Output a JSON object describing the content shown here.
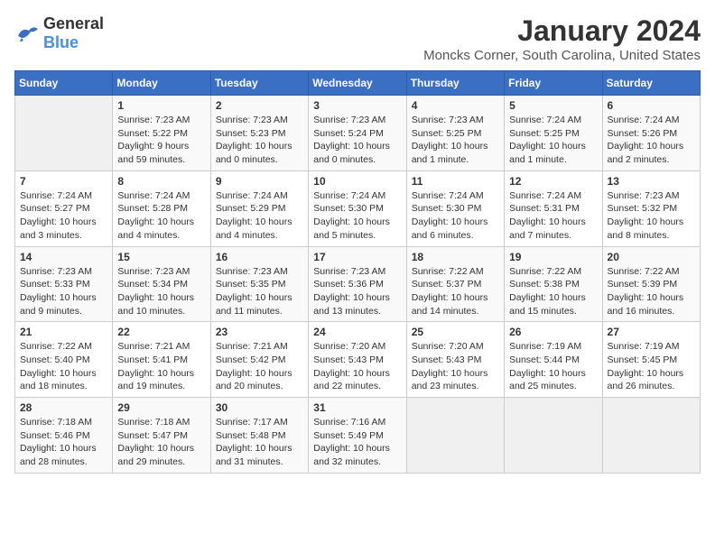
{
  "logo": {
    "general": "General",
    "blue": "Blue"
  },
  "title": "January 2024",
  "subtitle": "Moncks Corner, South Carolina, United States",
  "days_of_week": [
    "Sunday",
    "Monday",
    "Tuesday",
    "Wednesday",
    "Thursday",
    "Friday",
    "Saturday"
  ],
  "weeks": [
    [
      {
        "day": "",
        "empty": true
      },
      {
        "day": "1",
        "sunrise": "Sunrise: 7:23 AM",
        "sunset": "Sunset: 5:22 PM",
        "daylight": "Daylight: 9 hours and 59 minutes."
      },
      {
        "day": "2",
        "sunrise": "Sunrise: 7:23 AM",
        "sunset": "Sunset: 5:23 PM",
        "daylight": "Daylight: 10 hours and 0 minutes."
      },
      {
        "day": "3",
        "sunrise": "Sunrise: 7:23 AM",
        "sunset": "Sunset: 5:24 PM",
        "daylight": "Daylight: 10 hours and 0 minutes."
      },
      {
        "day": "4",
        "sunrise": "Sunrise: 7:23 AM",
        "sunset": "Sunset: 5:25 PM",
        "daylight": "Daylight: 10 hours and 1 minute."
      },
      {
        "day": "5",
        "sunrise": "Sunrise: 7:24 AM",
        "sunset": "Sunset: 5:25 PM",
        "daylight": "Daylight: 10 hours and 1 minute."
      },
      {
        "day": "6",
        "sunrise": "Sunrise: 7:24 AM",
        "sunset": "Sunset: 5:26 PM",
        "daylight": "Daylight: 10 hours and 2 minutes."
      }
    ],
    [
      {
        "day": "7",
        "sunrise": "Sunrise: 7:24 AM",
        "sunset": "Sunset: 5:27 PM",
        "daylight": "Daylight: 10 hours and 3 minutes."
      },
      {
        "day": "8",
        "sunrise": "Sunrise: 7:24 AM",
        "sunset": "Sunset: 5:28 PM",
        "daylight": "Daylight: 10 hours and 4 minutes."
      },
      {
        "day": "9",
        "sunrise": "Sunrise: 7:24 AM",
        "sunset": "Sunset: 5:29 PM",
        "daylight": "Daylight: 10 hours and 4 minutes."
      },
      {
        "day": "10",
        "sunrise": "Sunrise: 7:24 AM",
        "sunset": "Sunset: 5:30 PM",
        "daylight": "Daylight: 10 hours and 5 minutes."
      },
      {
        "day": "11",
        "sunrise": "Sunrise: 7:24 AM",
        "sunset": "Sunset: 5:30 PM",
        "daylight": "Daylight: 10 hours and 6 minutes."
      },
      {
        "day": "12",
        "sunrise": "Sunrise: 7:24 AM",
        "sunset": "Sunset: 5:31 PM",
        "daylight": "Daylight: 10 hours and 7 minutes."
      },
      {
        "day": "13",
        "sunrise": "Sunrise: 7:23 AM",
        "sunset": "Sunset: 5:32 PM",
        "daylight": "Daylight: 10 hours and 8 minutes."
      }
    ],
    [
      {
        "day": "14",
        "sunrise": "Sunrise: 7:23 AM",
        "sunset": "Sunset: 5:33 PM",
        "daylight": "Daylight: 10 hours and 9 minutes."
      },
      {
        "day": "15",
        "sunrise": "Sunrise: 7:23 AM",
        "sunset": "Sunset: 5:34 PM",
        "daylight": "Daylight: 10 hours and 10 minutes."
      },
      {
        "day": "16",
        "sunrise": "Sunrise: 7:23 AM",
        "sunset": "Sunset: 5:35 PM",
        "daylight": "Daylight: 10 hours and 11 minutes."
      },
      {
        "day": "17",
        "sunrise": "Sunrise: 7:23 AM",
        "sunset": "Sunset: 5:36 PM",
        "daylight": "Daylight: 10 hours and 13 minutes."
      },
      {
        "day": "18",
        "sunrise": "Sunrise: 7:22 AM",
        "sunset": "Sunset: 5:37 PM",
        "daylight": "Daylight: 10 hours and 14 minutes."
      },
      {
        "day": "19",
        "sunrise": "Sunrise: 7:22 AM",
        "sunset": "Sunset: 5:38 PM",
        "daylight": "Daylight: 10 hours and 15 minutes."
      },
      {
        "day": "20",
        "sunrise": "Sunrise: 7:22 AM",
        "sunset": "Sunset: 5:39 PM",
        "daylight": "Daylight: 10 hours and 16 minutes."
      }
    ],
    [
      {
        "day": "21",
        "sunrise": "Sunrise: 7:22 AM",
        "sunset": "Sunset: 5:40 PM",
        "daylight": "Daylight: 10 hours and 18 minutes."
      },
      {
        "day": "22",
        "sunrise": "Sunrise: 7:21 AM",
        "sunset": "Sunset: 5:41 PM",
        "daylight": "Daylight: 10 hours and 19 minutes."
      },
      {
        "day": "23",
        "sunrise": "Sunrise: 7:21 AM",
        "sunset": "Sunset: 5:42 PM",
        "daylight": "Daylight: 10 hours and 20 minutes."
      },
      {
        "day": "24",
        "sunrise": "Sunrise: 7:20 AM",
        "sunset": "Sunset: 5:43 PM",
        "daylight": "Daylight: 10 hours and 22 minutes."
      },
      {
        "day": "25",
        "sunrise": "Sunrise: 7:20 AM",
        "sunset": "Sunset: 5:43 PM",
        "daylight": "Daylight: 10 hours and 23 minutes."
      },
      {
        "day": "26",
        "sunrise": "Sunrise: 7:19 AM",
        "sunset": "Sunset: 5:44 PM",
        "daylight": "Daylight: 10 hours and 25 minutes."
      },
      {
        "day": "27",
        "sunrise": "Sunrise: 7:19 AM",
        "sunset": "Sunset: 5:45 PM",
        "daylight": "Daylight: 10 hours and 26 minutes."
      }
    ],
    [
      {
        "day": "28",
        "sunrise": "Sunrise: 7:18 AM",
        "sunset": "Sunset: 5:46 PM",
        "daylight": "Daylight: 10 hours and 28 minutes."
      },
      {
        "day": "29",
        "sunrise": "Sunrise: 7:18 AM",
        "sunset": "Sunset: 5:47 PM",
        "daylight": "Daylight: 10 hours and 29 minutes."
      },
      {
        "day": "30",
        "sunrise": "Sunrise: 7:17 AM",
        "sunset": "Sunset: 5:48 PM",
        "daylight": "Daylight: 10 hours and 31 minutes."
      },
      {
        "day": "31",
        "sunrise": "Sunrise: 7:16 AM",
        "sunset": "Sunset: 5:49 PM",
        "daylight": "Daylight: 10 hours and 32 minutes."
      },
      {
        "day": "",
        "empty": true
      },
      {
        "day": "",
        "empty": true
      },
      {
        "day": "",
        "empty": true
      }
    ]
  ]
}
